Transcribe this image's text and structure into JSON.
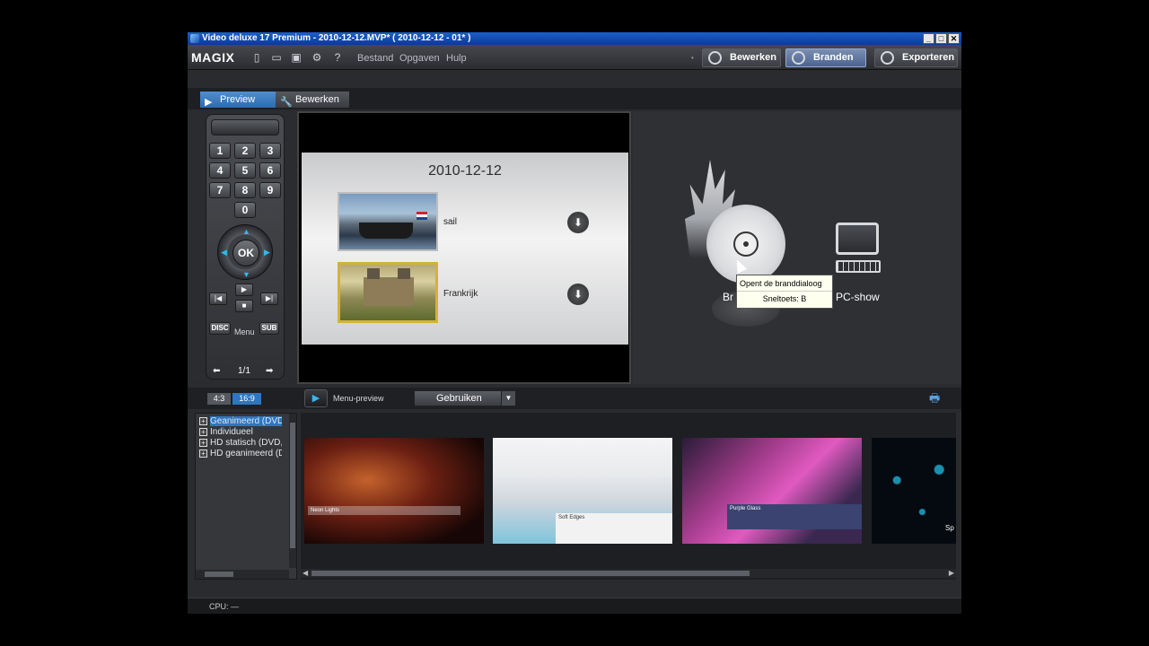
{
  "window": {
    "title": "Video deluxe 17 Premium - 2010-12-12.MVP* ( 2010-12-12 - 01* )",
    "controls": [
      "_",
      "□",
      "✕"
    ]
  },
  "menubar": {
    "logo": "MAGIX",
    "menus": [
      "Bestand",
      "Opgaven",
      "Hulp"
    ],
    "modes": [
      {
        "label": "Bewerken",
        "active": false
      },
      {
        "label": "Branden",
        "active": true
      },
      {
        "label": "Exporteren",
        "active": false
      }
    ]
  },
  "subtabs": {
    "preview": "Preview",
    "edit": "Bewerken"
  },
  "remote": {
    "keys": [
      "1",
      "2",
      "3",
      "4",
      "5",
      "6",
      "7",
      "8",
      "9",
      "0"
    ],
    "ok": "OK",
    "disc": "DISC",
    "menu": "Menu",
    "sub": "SUB",
    "page": "1/1"
  },
  "menu_preview": {
    "title": "2010-12-12",
    "entries": [
      {
        "label": "sail"
      },
      {
        "label": "Frankrijk"
      }
    ]
  },
  "burn": {
    "burn_label": "Br",
    "pc_label": "PC-show",
    "tooltip": {
      "line1": "Opent de branddialoog",
      "line2": "Sneltoets: B"
    }
  },
  "bottom": {
    "ratio_43": "4:3",
    "ratio_169": "16:9",
    "menu_preview_label": "Menu-preview",
    "use_button": "Gebruiken"
  },
  "tree": {
    "items": [
      {
        "label": "Geanimeerd (DVD)",
        "selected": true
      },
      {
        "label": "Individueel",
        "selected": false
      },
      {
        "label": "HD statisch (DVD, B",
        "selected": false
      },
      {
        "label": "HD geanimeerd (DV",
        "selected": false
      }
    ]
  },
  "templates": [
    {
      "label": "Neon Lights"
    },
    {
      "label": "Soft Edges"
    },
    {
      "label": "Purple Glass"
    },
    {
      "label": "Sp"
    }
  ],
  "status": {
    "cpu": "CPU: —"
  },
  "colors": {
    "accent": "#2e76c0",
    "highlight": "#35b7e8"
  }
}
